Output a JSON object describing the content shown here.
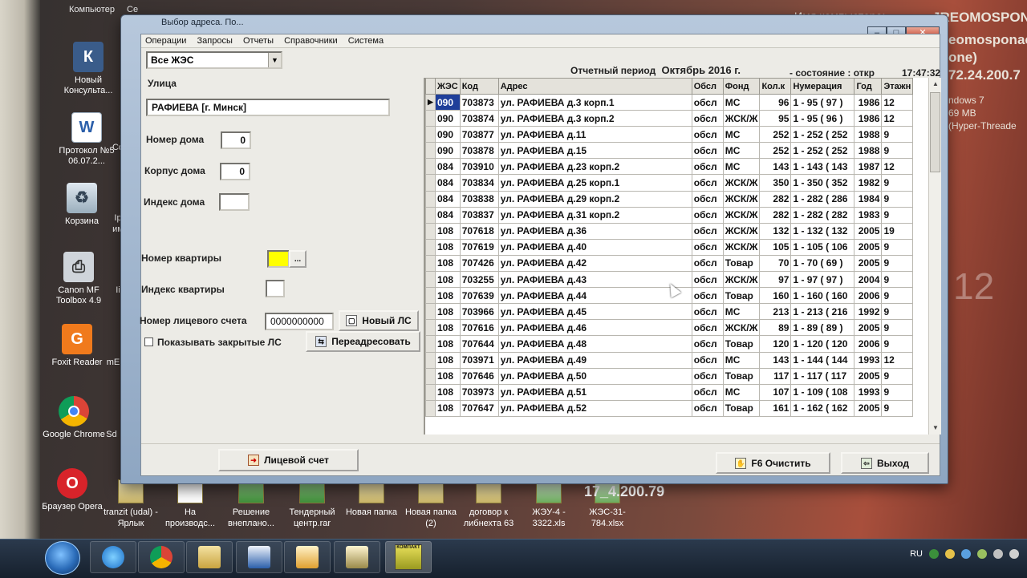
{
  "desktop": {
    "top_labels": [
      "Компьютер",
      "Се"
    ],
    "left_icons": [
      {
        "label": "Новый Консульта...",
        "icon": "consultant-icon"
      },
      {
        "label": "Протокол №5 06.07.2...",
        "icon": "word-doc-icon"
      },
      {
        "label": "Корзина",
        "icon": "recycle-bin-icon"
      },
      {
        "label": "Canon MF Toolbox 4.9",
        "icon": "printer-icon"
      },
      {
        "label": "Foxit Reader",
        "icon": "foxit-icon"
      },
      {
        "label": "Google Chrome",
        "icon": "chrome-icon"
      },
      {
        "label": "Браузер Opera",
        "icon": "opera-icon"
      }
    ],
    "partial_icons": [
      "Со",
      "Ір",
      "им",
      "Іі",
      "mE",
      "Sd"
    ],
    "bottom_files": [
      "tranzit (udal) - Ярлык",
      "На производс...",
      "Решение внеплано...",
      "Тендерный центр.rar",
      "Новая папка",
      "Новая папка (2)",
      "договор к либнехта 63",
      "ЖЭУ-4 - 3322.xls",
      "ЖЭС-31-784.xlsx"
    ],
    "ip_overlay": "17_4.200.79",
    "bginfo": {
      "computer_name_label": "Имя компьютера:",
      "computer_name": "JREOMOSPON",
      "line2": "eomosponac",
      "line3": "one)",
      "ip": "72.24.200.7",
      "os": "ndows 7",
      "mem": "69 MB",
      "cpu": "(Hyper-Threade",
      "clock_big": "12"
    }
  },
  "window": {
    "title": "Выбор адреса. По...",
    "buttons": {
      "minimize": "–",
      "maximize": "□",
      "close": "✕"
    }
  },
  "menu": [
    "Операции",
    "Запросы",
    "Отчеты",
    "Справочники",
    "Система"
  ],
  "filter": {
    "zhes_select": "Все ЖЭС"
  },
  "status": {
    "period_label": "Отчетный период",
    "period_value": "Октябрь 2016 г.",
    "state": "- состояние : откр",
    "time": "17:47:32"
  },
  "form": {
    "street_label": "Улица",
    "street_value": "РАФИЕВА [г. Минск]",
    "house_label": "Номер дома",
    "house_value": "0",
    "korpus_label": "Корпус дома",
    "korpus_value": "0",
    "house_index_label": "Индекс дома",
    "house_index_value": "",
    "apt_label": "Номер квартиры",
    "apt_button": "...",
    "apt_index_label": "Индекс квартиры",
    "account_label": "Номер лицевого счета",
    "account_value": "0000000000",
    "new_account_button": "Новый ЛС",
    "show_closed_label": "Показывать закрытые ЛС",
    "readdress_button": "Переадресовать"
  },
  "grid": {
    "columns": [
      "ЖЭС",
      "Код",
      "Адрес",
      "Обсл",
      "Фонд",
      "Кол.к",
      "Нумерация",
      "Год",
      "Этажн"
    ],
    "rows": [
      [
        "090",
        "703873",
        "ул. РАФИЕВА д.3 корп.1",
        "обсл",
        "МС",
        "96",
        "1 - 95 ( 97 )",
        "1986",
        "12"
      ],
      [
        "090",
        "703874",
        "ул. РАФИЕВА д.3 корп.2",
        "обсл",
        "ЖСК/Ж",
        "95",
        "1 - 95 ( 96 )",
        "1986",
        "12"
      ],
      [
        "090",
        "703877",
        "ул. РАФИЕВА д.11",
        "обсл",
        "МС",
        "252",
        "1 - 252 ( 252",
        "1988",
        "9"
      ],
      [
        "090",
        "703878",
        "ул. РАФИЕВА д.15",
        "обсл",
        "МС",
        "252",
        "1 - 252 ( 252",
        "1988",
        "9"
      ],
      [
        "084",
        "703910",
        "ул. РАФИЕВА д.23 корп.2",
        "обсл",
        "МС",
        "143",
        "1 - 143 ( 143",
        "1987",
        "12"
      ],
      [
        "084",
        "703834",
        "ул. РАФИЕВА д.25 корп.1",
        "обсл",
        "ЖСК/Ж",
        "350",
        "1 - 350 ( 352",
        "1982",
        "9"
      ],
      [
        "084",
        "703838",
        "ул. РАФИЕВА д.29 корп.2",
        "обсл",
        "ЖСК/Ж",
        "282",
        "1 - 282 ( 286",
        "1984",
        "9"
      ],
      [
        "084",
        "703837",
        "ул. РАФИЕВА д.31 корп.2",
        "обсл",
        "ЖСК/Ж",
        "282",
        "1 - 282 ( 282",
        "1983",
        "9"
      ],
      [
        "108",
        "707618",
        "ул. РАФИЕВА д.36",
        "обсл",
        "ЖСК/Ж",
        "132",
        "1 - 132 ( 132",
        "2005",
        "19"
      ],
      [
        "108",
        "707619",
        "ул. РАФИЕВА д.40",
        "обсл",
        "ЖСК/Ж",
        "105",
        "1 - 105 ( 106",
        "2005",
        "9"
      ],
      [
        "108",
        "707426",
        "ул. РАФИЕВА д.42",
        "обсл",
        "Товар",
        "70",
        "1 - 70 ( 69 )",
        "2005",
        "9"
      ],
      [
        "108",
        "703255",
        "ул. РАФИЕВА д.43",
        "обсл",
        "ЖСК/Ж",
        "97",
        "1 - 97 ( 97 )",
        "2004",
        "9"
      ],
      [
        "108",
        "707639",
        "ул. РАФИЕВА д.44",
        "обсл",
        "Товар",
        "160",
        "1 - 160 ( 160",
        "2006",
        "9"
      ],
      [
        "108",
        "703966",
        "ул. РАФИЕВА д.45",
        "обсл",
        "МС",
        "213",
        "1 - 213 ( 216",
        "1992",
        "9"
      ],
      [
        "108",
        "707616",
        "ул. РАФИЕВА д.46",
        "обсл",
        "ЖСК/Ж",
        "89",
        "1 - 89 ( 89 )",
        "2005",
        "9"
      ],
      [
        "108",
        "707644",
        "ул. РАФИЕВА д.48",
        "обсл",
        "Товар",
        "120",
        "1 - 120 ( 120",
        "2006",
        "9"
      ],
      [
        "108",
        "703971",
        "ул. РАФИЕВА д.49",
        "обсл",
        "МС",
        "143",
        "1 - 144 ( 144",
        "1993",
        "12"
      ],
      [
        "108",
        "707646",
        "ул. РАФИЕВА д.50",
        "обсл",
        "Товар",
        "117",
        "1 - 117 ( 117",
        "2005",
        "9"
      ],
      [
        "108",
        "703973",
        "ул. РАФИЕВА д.51",
        "обсл",
        "МС",
        "107",
        "1 - 109 ( 108",
        "1993",
        "9"
      ],
      [
        "108",
        "707647",
        "ул. РАФИЕВА д.52",
        "обсл",
        "Товар",
        "161",
        "1 - 162 ( 162",
        "2005",
        "9"
      ]
    ]
  },
  "footer": {
    "account_button": "Лицевой счет",
    "clear_button": "F6  Очистить",
    "exit_button": "Выход"
  },
  "taskbar": {
    "lang": "RU",
    "apps": [
      "ie-icon",
      "chrome-icon",
      "explorer-icon",
      "word-icon",
      "outlook-icon",
      "help-icon",
      "kompakt-app-icon"
    ],
    "active_app_label": "КОМПАКТ"
  },
  "colors": {
    "selection": "#1f3f9a",
    "apt_field": "#ffff00",
    "window_frame": "#9fb4cc",
    "client_bg": "#ecebe6"
  }
}
